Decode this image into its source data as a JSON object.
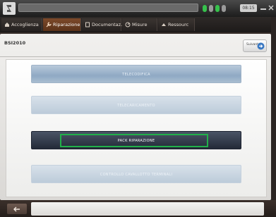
{
  "app": {
    "address_text": "",
    "time_text": "08:15"
  },
  "tabs": [
    {
      "label": "Accoglienza",
      "icon": "home-icon",
      "active": false
    },
    {
      "label": "Riparazione",
      "icon": "wrench-icon",
      "active": true
    },
    {
      "label": "Documentaz...",
      "icon": "document-icon",
      "active": false
    },
    {
      "label": "Misure",
      "icon": "meter-icon",
      "active": false
    },
    {
      "label": "Ressourc",
      "icon": "resource-icon",
      "active": false
    }
  ],
  "panel": {
    "title": "BSI2010",
    "help_label": "Suivant"
  },
  "menu": [
    {
      "label": "TELECODIFICA",
      "style": "light"
    },
    {
      "label": "TELECARICAMENTO",
      "style": "faded"
    },
    {
      "label": "PACK RIPARAZIONE",
      "style": "dark",
      "selected": true
    },
    {
      "label": "CONTROLLO CAVALLOTTO TERMINALI",
      "style": "faded"
    }
  ],
  "colors": {
    "selection": "#21b04a",
    "active_tab": "#7d4a2b"
  }
}
